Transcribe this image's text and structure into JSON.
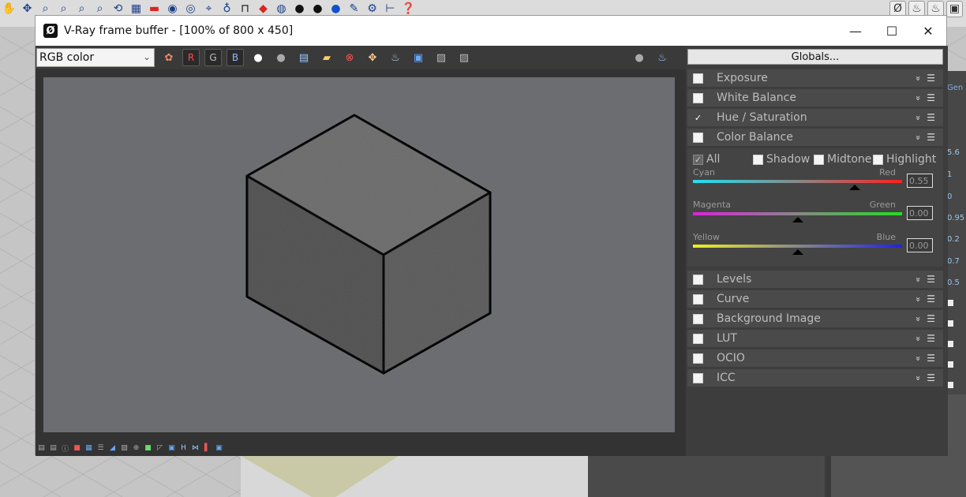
{
  "window": {
    "title": "V-Ray frame buffer - [100% of 800 x 450]",
    "minimize": "—",
    "maximize": "☐",
    "close": "✕"
  },
  "toolbar": {
    "channel_select": "RGB color",
    "channel_r": "R",
    "channel_g": "G",
    "channel_b": "B"
  },
  "panel": {
    "globals_label": "Globals...",
    "layers": [
      {
        "label": "Exposure",
        "checked": false
      },
      {
        "label": "White Balance",
        "checked": false
      },
      {
        "label": "Hue / Saturation",
        "checked": true
      },
      {
        "label": "Color Balance",
        "checked": false
      },
      {
        "label": "Levels",
        "checked": false
      },
      {
        "label": "Curve",
        "checked": false
      },
      {
        "label": "Background Image",
        "checked": false
      },
      {
        "label": "LUT",
        "checked": false
      },
      {
        "label": "OCIO",
        "checked": false
      },
      {
        "label": "ICC",
        "checked": false
      }
    ],
    "check_mark": "✓",
    "color_balance": {
      "tones": {
        "all": "All",
        "shadows": "Shadow",
        "midtones": "Midtone",
        "highlights": "Highlight"
      },
      "sliders": [
        {
          "left": "Cyan",
          "right": "Red",
          "value": "0.55",
          "position": 0.775,
          "left_color": "#22e0f0",
          "right_color": "#ff2020"
        },
        {
          "left": "Magenta",
          "right": "Green",
          "value": "0.00",
          "position": 0.5,
          "left_color": "#e020e0",
          "right_color": "#20e020"
        },
        {
          "left": "Yellow",
          "right": "Blue",
          "value": "0.00",
          "position": 0.5,
          "left_color": "#f0f020",
          "right_color": "#2020f0"
        }
      ]
    }
  },
  "bg_panel": {
    "tab": "Gen",
    "values": [
      "5.6",
      "1",
      "0",
      "0.95",
      "0.2",
      "0.7",
      "0.5"
    ]
  },
  "colors": {
    "frame_bg": "#333333",
    "render_bg": "#6c6d70",
    "cube_top": "#6a6a6a",
    "cube_left": "#4f4f4f",
    "cube_right": "#595959"
  }
}
